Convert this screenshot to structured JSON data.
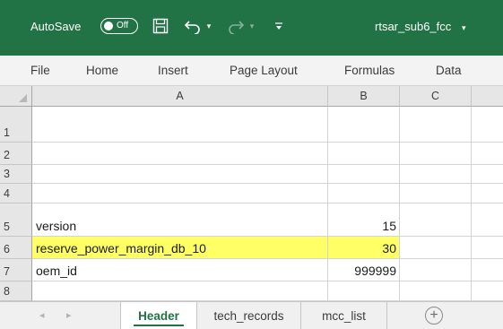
{
  "titlebar": {
    "autosave_label": "AutoSave",
    "autosave_state": "Off",
    "document_title": "rtsar_sub6_fcc",
    "title_dropdown": "▾",
    "undo_dropdown": "▾",
    "redo_dropdown": "▾",
    "qat_dropdown": "▾",
    "accent_color": "#217346"
  },
  "ribbon": {
    "tabs": [
      "File",
      "Home",
      "Insert",
      "Page Layout",
      "Formulas",
      "Data"
    ]
  },
  "grid": {
    "columns": [
      "A",
      "B",
      "C"
    ],
    "rows": [
      {
        "number": "1",
        "a": "",
        "b": ""
      },
      {
        "number": "2",
        "a": "",
        "b": ""
      },
      {
        "number": "3",
        "a": "",
        "b": ""
      },
      {
        "number": "4",
        "a": "",
        "b": ""
      },
      {
        "number": "5",
        "a": "version",
        "b": "15"
      },
      {
        "number": "6",
        "a": "reserve_power_margin_db_10",
        "b": "30",
        "highlighted": true
      },
      {
        "number": "7",
        "a": "oem_id",
        "b": "999999"
      },
      {
        "number": "8",
        "a": "",
        "b": ""
      }
    ],
    "highlight_color": "#ffff66"
  },
  "sheets": {
    "tabs": [
      "Header",
      "tech_records",
      "mcc_list"
    ],
    "active": "Header",
    "nav_prev": "◂",
    "nav_next": "▸",
    "add_symbol": "+"
  }
}
